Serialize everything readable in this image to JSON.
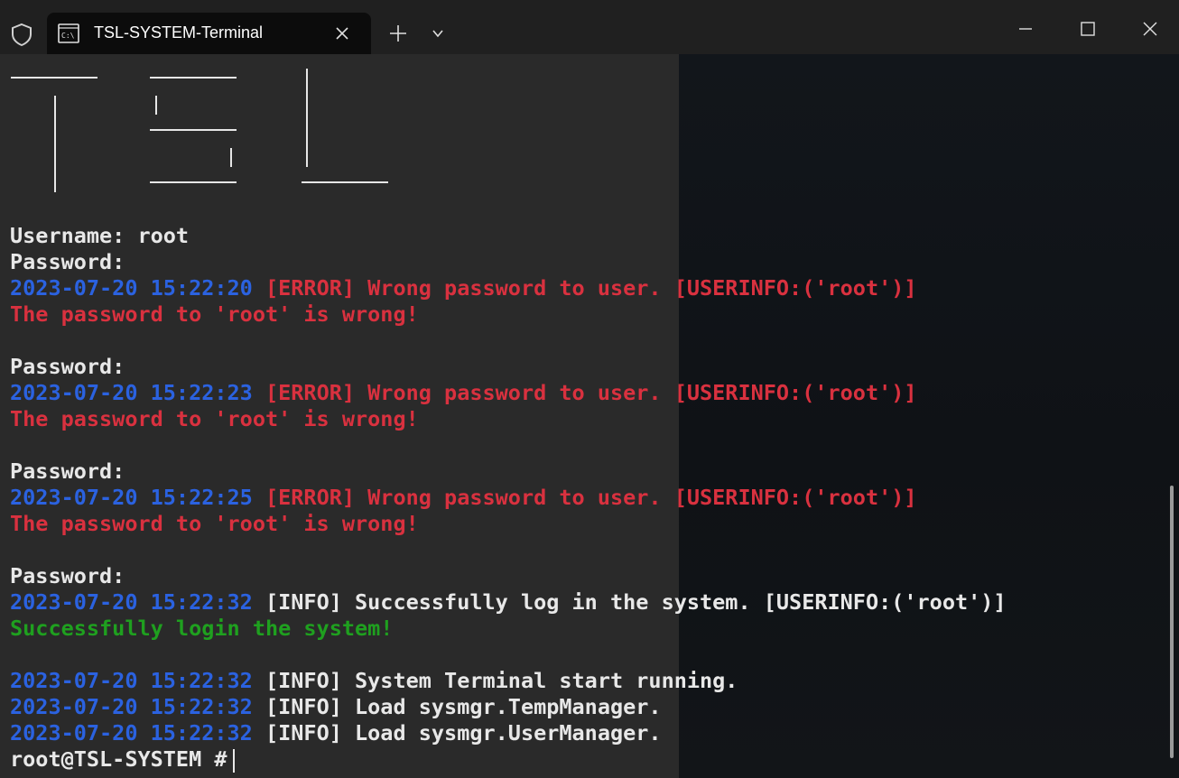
{
  "titlebar": {
    "tab_title": "TSL-SYSTEM-Terminal",
    "tab_icon_glyph": "C:\\",
    "icons": {
      "shield": "shield-icon",
      "terminal": "terminal-icon",
      "close_tab": "close-icon",
      "new_tab": "plus-icon",
      "dropdown": "chevron-down-icon",
      "minimize": "minimize-icon",
      "maximize": "maximize-icon",
      "close_window": "close-icon"
    }
  },
  "terminal": {
    "login_1": {
      "username_label": "Username: ",
      "username_value": "root",
      "password_label": "Password:"
    },
    "attempt_1": {
      "timestamp": "2023-07-20 15:22:20",
      "log": " [ERROR] Wrong password to user. [USERINFO:('root')]",
      "message": "The password to 'root' is wrong!"
    },
    "password_2": "Password:",
    "attempt_2": {
      "timestamp": "2023-07-20 15:22:23",
      "log": " [ERROR] Wrong password to user. [USERINFO:('root')]",
      "message": "The password to 'root' is wrong!"
    },
    "password_3": "Password:",
    "attempt_3": {
      "timestamp": "2023-07-20 15:22:25",
      "log": " [ERROR] Wrong password to user. [USERINFO:('root')]",
      "message": "The password to 'root' is wrong!"
    },
    "password_4": "Password:",
    "success": {
      "timestamp": "2023-07-20 15:22:32",
      "log": " [INFO] Successfully log in the system. [USERINFO:('root')]",
      "message": "Successfully login the system!"
    },
    "startup": [
      {
        "timestamp": "2023-07-20 15:22:32",
        "log": " [INFO] System Terminal start running."
      },
      {
        "timestamp": "2023-07-20 15:22:32",
        "log": " [INFO] Load sysmgr.TempManager."
      },
      {
        "timestamp": "2023-07-20 15:22:32",
        "log": " [INFO] Load sysmgr.UserManager."
      }
    ],
    "prompt": "root@TSL-SYSTEM #"
  },
  "colors": {
    "timestamp": "#2b62e0",
    "error": "#d9313f",
    "success": "#1fa01f",
    "text": "#e8e8e8",
    "background": "#0c0c0c"
  }
}
